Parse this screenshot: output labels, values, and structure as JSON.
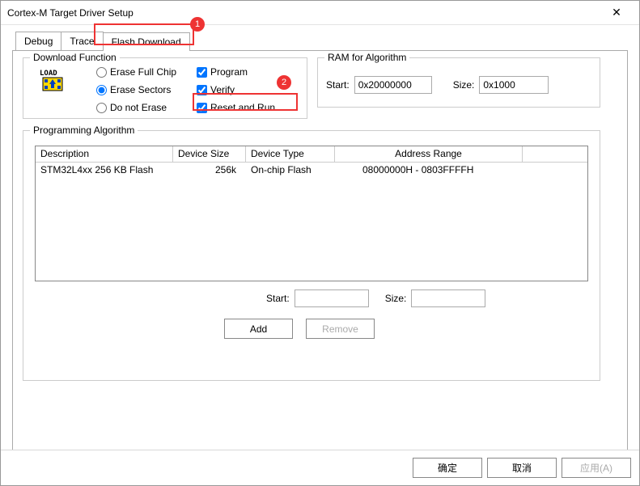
{
  "window": {
    "title": "Cortex-M Target Driver Setup",
    "close_glyph": "✕"
  },
  "tabs": {
    "debug": "Debug",
    "trace": "Trace",
    "flash_download": "Flash Download"
  },
  "annotations": {
    "badge1": "1",
    "badge2": "2"
  },
  "download_function": {
    "legend": "Download Function",
    "radios": {
      "erase_full_chip": "Erase Full Chip",
      "erase_sectors": "Erase Sectors",
      "do_not_erase": "Do not Erase",
      "selected": "erase_sectors"
    },
    "checks": {
      "program": {
        "label": "Program",
        "checked": true
      },
      "verify": {
        "label": "Verify",
        "checked": true
      },
      "reset_and_run": {
        "label": "Reset and Run",
        "checked": true
      }
    }
  },
  "ram": {
    "legend": "RAM for Algorithm",
    "start_label": "Start:",
    "start_value": "0x20000000",
    "size_label": "Size:",
    "size_value": "0x1000"
  },
  "programming_algorithm": {
    "legend": "Programming Algorithm",
    "headers": {
      "description": "Description",
      "device_size": "Device Size",
      "device_type": "Device Type",
      "address_range": "Address Range"
    },
    "rows": [
      {
        "description": "STM32L4xx 256 KB Flash",
        "device_size": "256k",
        "device_type": "On-chip Flash",
        "address_range": "08000000H - 0803FFFFH"
      }
    ],
    "start_label": "Start:",
    "start_value": "",
    "size_label": "Size:",
    "size_value": "",
    "add_button": "Add",
    "remove_button": "Remove"
  },
  "buttons": {
    "ok": "确定",
    "cancel": "取消",
    "apply": "应用(A)"
  }
}
